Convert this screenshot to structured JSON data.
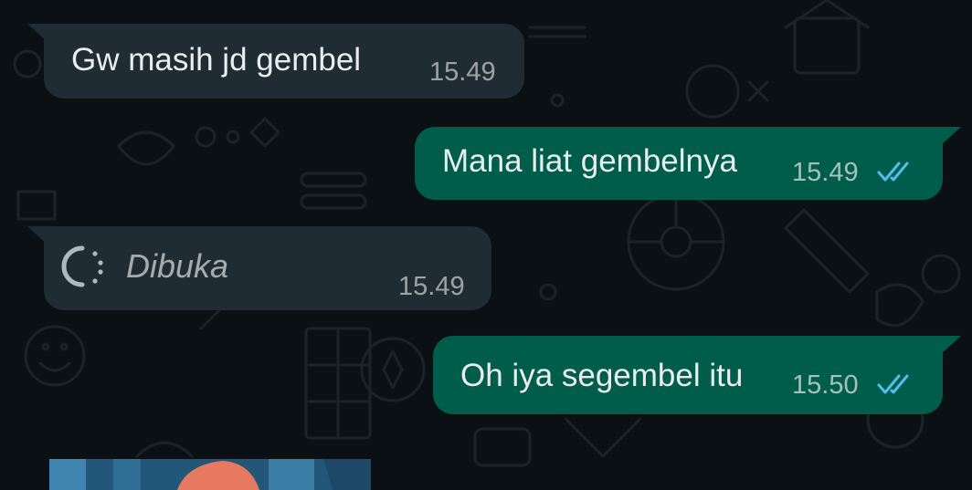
{
  "chat": {
    "messages": [
      {
        "direction": "incoming",
        "text": "Gw masih jd gembel",
        "time": "15.49"
      },
      {
        "direction": "outgoing",
        "text": "Mana liat gembelnya",
        "time": "15.49",
        "status": "read"
      },
      {
        "direction": "incoming",
        "type": "view-once-opened",
        "text": "Dibuka",
        "time": "15.49"
      },
      {
        "direction": "outgoing",
        "text": "Oh iya segembel itu",
        "time": "15.50",
        "status": "read"
      }
    ]
  },
  "colors": {
    "background": "#0b1014",
    "incoming_bubble": "#202c33",
    "outgoing_bubble": "#005c4b",
    "read_tick": "#53bdeb",
    "text": "#e9edef"
  },
  "icons": {
    "read_receipt": "double-check-icon",
    "view_once": "view-once-opened-icon"
  }
}
